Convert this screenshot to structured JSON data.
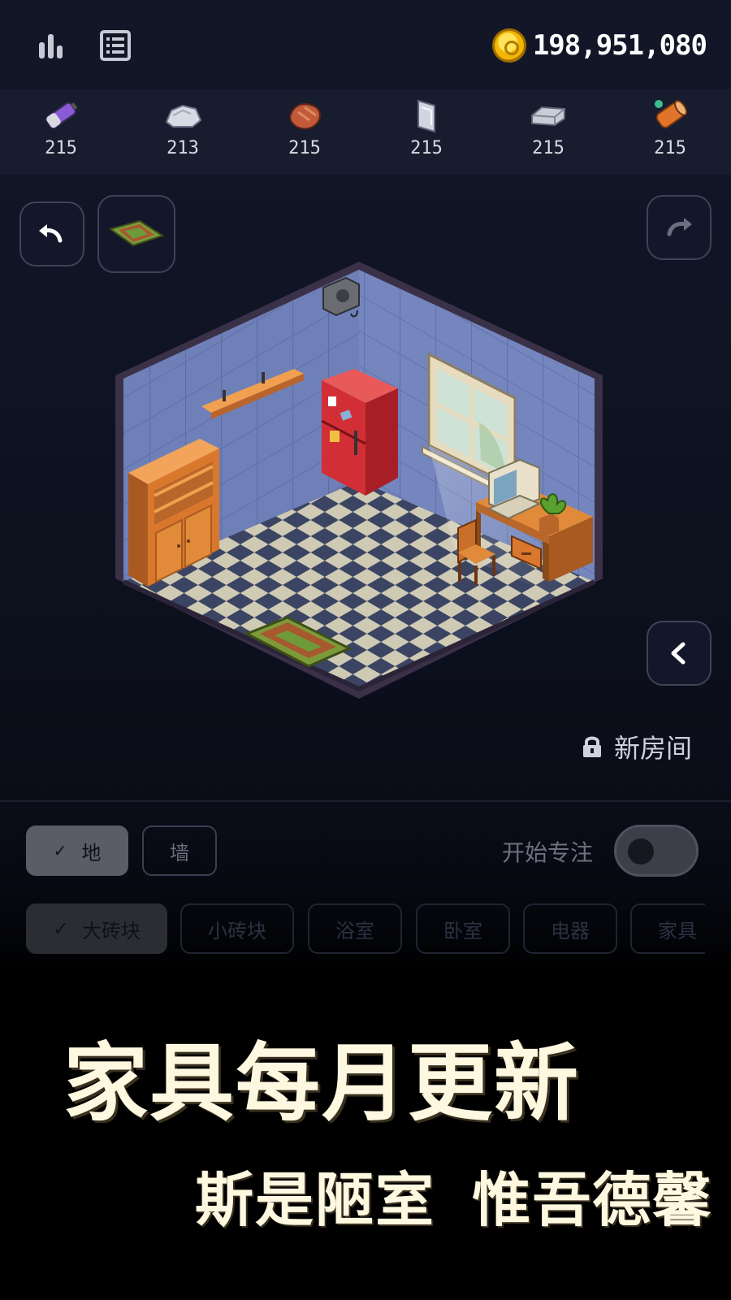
{
  "header": {
    "stats_icon": "bar-chart-icon",
    "list_icon": "list-icon",
    "coin_icon": "gold-coin-icon",
    "coins": "198,951,080"
  },
  "materials": [
    {
      "name": "battery-icon",
      "count": "215"
    },
    {
      "name": "stone-icon",
      "count": "213"
    },
    {
      "name": "leather-icon",
      "count": "215"
    },
    {
      "name": "glass-icon",
      "count": "215"
    },
    {
      "name": "metal-bar-icon",
      "count": "215"
    },
    {
      "name": "wood-log-icon",
      "count": "215"
    }
  ],
  "edit": {
    "undo_icon": "undo-icon",
    "redo_icon": "redo-icon",
    "selected_item_icon": "rug-icon",
    "collapse_icon": "chevron-left-icon"
  },
  "room": {
    "lock_icon": "lock-icon",
    "label": "新房间"
  },
  "layers": {
    "floor": "地",
    "wall": "墙",
    "selected": "floor"
  },
  "focus": {
    "label": "开始专注",
    "enabled": false
  },
  "categories": [
    "大砖块",
    "小砖块",
    "浴室",
    "卧室",
    "电器",
    "家具"
  ],
  "category_selected": "大砖块",
  "promo": {
    "title": "家具每月更新",
    "subtitle": "斯是陋室 惟吾德馨"
  },
  "colors": {
    "wall": "#6f80b8",
    "floor_dark": "#3b4563",
    "floor_light": "#cfcab4",
    "fridge": "#d12f35",
    "wood": "#d97a2b"
  }
}
